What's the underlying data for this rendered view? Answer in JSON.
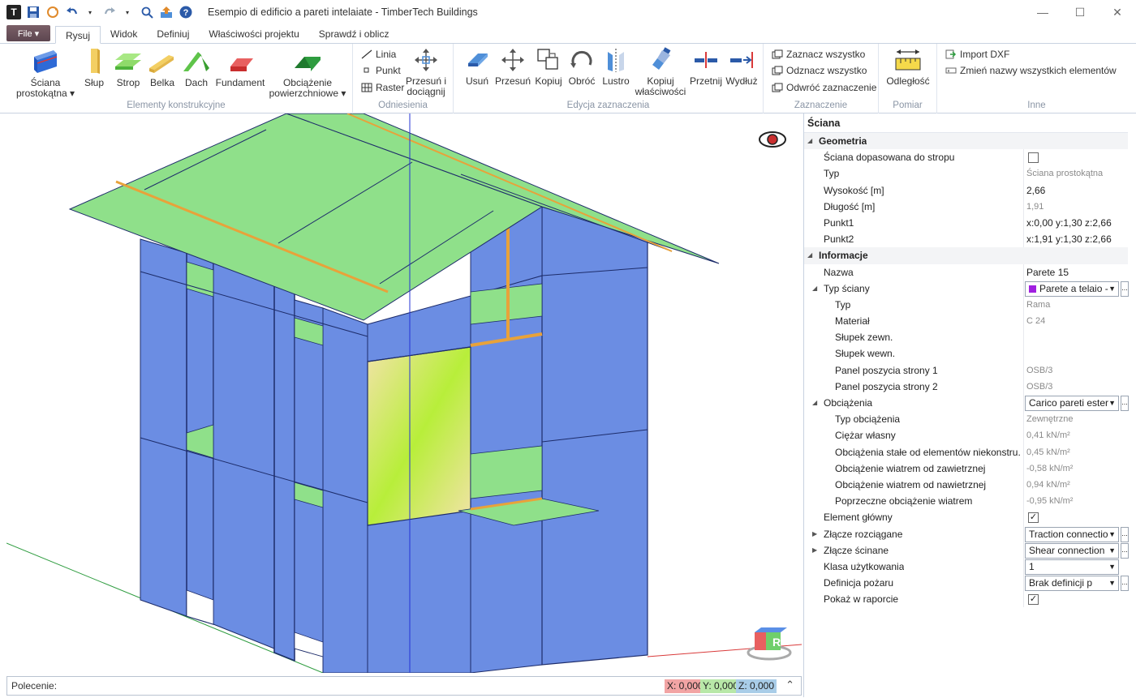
{
  "title_bar": {
    "title": "Esempio di edificio a pareti intelaiate - TimberTech Buildings",
    "app_logo": "T",
    "minimize": "—",
    "maximize": "☐",
    "close": "✕"
  },
  "tabs": {
    "file": "File ▾",
    "items": [
      "Rysuj",
      "Widok",
      "Definiuj",
      "Właściwości projektu",
      "Sprawdź i oblicz"
    ]
  },
  "ribbon": {
    "elements": {
      "label": "Elementy konstrukcyjne",
      "wall_1": "Ściana",
      "wall_2": "prostokątna ▾",
      "column": "Słup",
      "slab": "Strop",
      "beam": "Belka",
      "roof": "Dach",
      "foundation": "Fundament",
      "surface_load_1": "Obciążenie",
      "surface_load_2": "powierzchniowe ▾"
    },
    "snaps": {
      "label": "Odniesienia",
      "line": "Linia",
      "point": "Punkt",
      "grid": "Raster",
      "move_1": "Przesuń i",
      "move_2": "dociągnij"
    },
    "edit": {
      "label": "Edycja zaznaczenia",
      "delete": "Usuń",
      "move": "Przesuń",
      "copy": "Kopiuj",
      "rotate": "Obróć",
      "mirror": "Lustro",
      "copy_props_1": "Kopiuj",
      "copy_props_2": "właściwości",
      "cut": "Przetnij",
      "extend": "Wydłuż"
    },
    "selection": {
      "label": "Zaznaczenie",
      "select_all": "Zaznacz wszystko",
      "deselect_all": "Odznacz wszystko",
      "invert": "Odwróć zaznaczenie"
    },
    "measure": {
      "label": "Pomiar",
      "distance": "Odległość"
    },
    "other": {
      "label": "Inne",
      "import_dxf": "Import DXF",
      "rename_all": "Zmień nazwy wszystkich elementów"
    }
  },
  "viewport": {
    "nav_cube_label": "R"
  },
  "command_bar": {
    "label": "Polecenie:",
    "x": "X: 0,000",
    "y": "Y: 0,000",
    "z": "Z: 0,000",
    "chevron": "⌃"
  },
  "properties": {
    "title": "Ściana",
    "rows": [
      {
        "type": "section",
        "label": "Geometria"
      },
      {
        "type": "check",
        "label": "Ściana dopasowana do stropu",
        "checked": false,
        "indent": 1
      },
      {
        "type": "value",
        "label": "Typ",
        "value": "Ściana prostokątna",
        "gray": true,
        "indent": 1
      },
      {
        "type": "value",
        "label": "Wysokość [m]",
        "value": "2,66",
        "gray": false,
        "indent": 1
      },
      {
        "type": "value",
        "label": "Długość [m]",
        "value": "1,91",
        "gray": true,
        "indent": 1
      },
      {
        "type": "value",
        "label": "Punkt1",
        "value": "x:0,00 y:1,30 z:2,66",
        "gray": false,
        "indent": 1
      },
      {
        "type": "value",
        "label": "Punkt2",
        "value": "x:1,91 y:1,30 z:2,66",
        "gray": false,
        "indent": 1
      },
      {
        "type": "section",
        "label": "Informacje"
      },
      {
        "type": "value",
        "label": "Nazwa",
        "value": "Parete 15",
        "gray": false,
        "indent": 1
      },
      {
        "type": "dropdown",
        "label": "Typ ściany",
        "value": "Parete a telaio - ",
        "swatch": true,
        "expander": "◢",
        "more": true,
        "indent": 1
      },
      {
        "type": "value",
        "label": "Typ",
        "value": "Rama",
        "gray": true,
        "indent": 2
      },
      {
        "type": "value",
        "label": "Materiał",
        "value": "C 24",
        "gray": true,
        "indent": 2
      },
      {
        "type": "value",
        "label": "Słupek zewn.",
        "value": "",
        "gray": true,
        "indent": 2
      },
      {
        "type": "value",
        "label": "Słupek wewn.",
        "value": "",
        "gray": true,
        "indent": 2
      },
      {
        "type": "value",
        "label": "Panel poszycia strony 1",
        "value": "OSB/3",
        "gray": true,
        "indent": 2
      },
      {
        "type": "value",
        "label": "Panel poszycia strony 2",
        "value": "OSB/3",
        "gray": true,
        "indent": 2
      },
      {
        "type": "dropdown",
        "label": "Obciążenia",
        "value": "Carico pareti ester",
        "swatch": false,
        "expander": "◢",
        "more": true,
        "indent": 1
      },
      {
        "type": "value",
        "label": "Typ obciążenia",
        "value": "Zewnętrzne",
        "gray": true,
        "indent": 2
      },
      {
        "type": "value",
        "label": "Ciężar własny",
        "value": "0,41 kN/m²",
        "gray": true,
        "indent": 2
      },
      {
        "type": "value",
        "label": "Obciążenia stałe od elementów niekonstru...",
        "value": "0,45 kN/m²",
        "gray": true,
        "indent": 2
      },
      {
        "type": "value",
        "label": "Obciążenie wiatrem od zawietrznej",
        "value": "-0,58 kN/m²",
        "gray": true,
        "indent": 2
      },
      {
        "type": "value",
        "label": "Obciążenie wiatrem od nawietrznej",
        "value": "0,94 kN/m²",
        "gray": true,
        "indent": 2
      },
      {
        "type": "value",
        "label": "Poprzeczne obciążenie wiatrem",
        "value": "-0,95 kN/m²",
        "gray": true,
        "indent": 2
      },
      {
        "type": "check",
        "label": "Element główny",
        "checked": true,
        "indent": 1
      },
      {
        "type": "dropdown",
        "label": "Złącze rozciągane",
        "value": "Traction connectio",
        "swatch": false,
        "expander": "▶",
        "more": true,
        "indent": 1
      },
      {
        "type": "dropdown",
        "label": "Złącze ścinane",
        "value": "Shear connection",
        "swatch": false,
        "expander": "▶",
        "more": true,
        "indent": 1
      },
      {
        "type": "dropdown",
        "label": "Klasa użytkowania",
        "value": "1",
        "swatch": false,
        "expander": "",
        "more": false,
        "indent": 1
      },
      {
        "type": "dropdown",
        "label": "Definicja pożaru",
        "value": "Brak definicji p",
        "swatch": false,
        "expander": "",
        "more": true,
        "indent": 1
      },
      {
        "type": "check",
        "label": "Pokaż w raporcie",
        "checked": true,
        "indent": 1
      }
    ]
  },
  "colors": {
    "wall_blue": "#6b8de3",
    "roof_green": "#8fe08a",
    "beam_orange": "#e8a23a",
    "selected_wall": "#c9ef3a"
  }
}
